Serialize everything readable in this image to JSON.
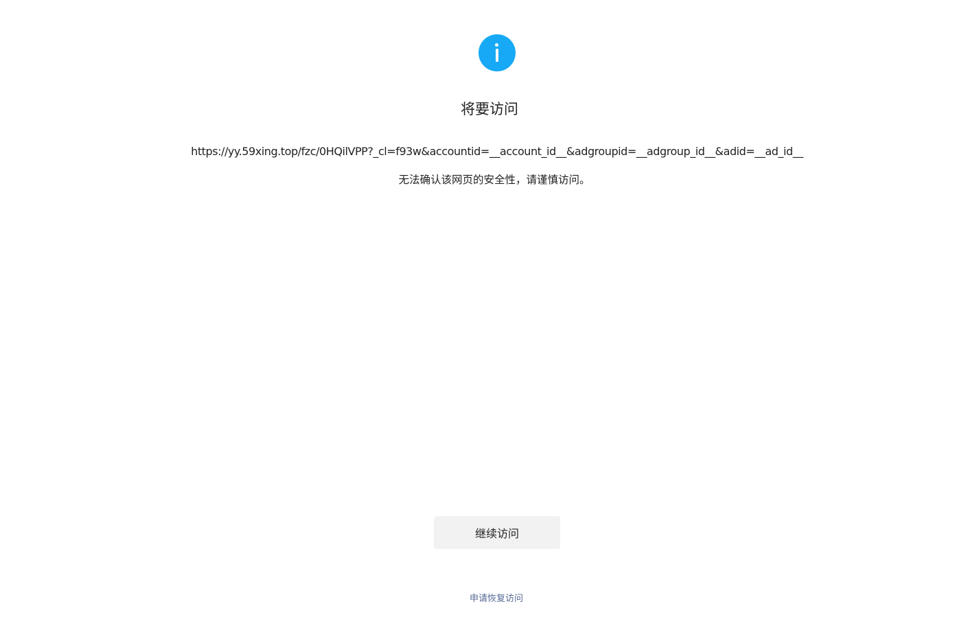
{
  "icon": "info-icon",
  "accent_color": "#17a9f5",
  "link_color": "#576b95",
  "dialog": {
    "title": "将要访问",
    "url": "https://yy.59xing.top/fzc/0HQilVPP?_cl=f93w&accountid=__account_id__&adgroupid=__adgroup_id__&adid=__ad_id__",
    "warning": "无法确认该网页的安全性，请谨慎访问。",
    "continue_label": "继续访问",
    "appeal_label": "申请恢复访问"
  }
}
